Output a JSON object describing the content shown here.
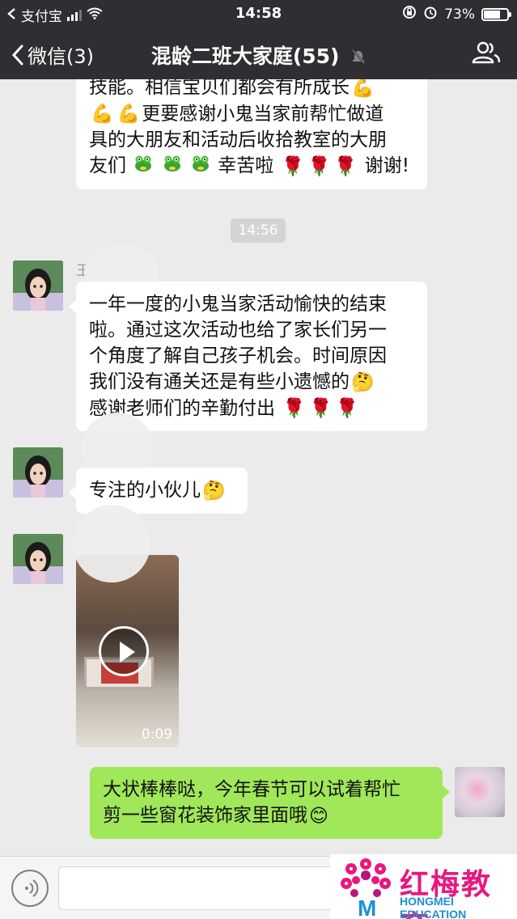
{
  "status_bar": {
    "carrier": "支付宝",
    "time": "14:58",
    "battery_percent": "73%",
    "battery_level": 0.73
  },
  "nav": {
    "back_label": "微信(3)",
    "title": "混龄二班大家庭(55)"
  },
  "messages": [
    {
      "id": "m1",
      "from": "other",
      "lines": [
        "技能。相信宝贝们都会有所成长",
        "更要感谢小鬼当家前帮忙做道",
        "具的大朋友和活动后收拾教室的大朋",
        "友们",
        "幸苦啦",
        "谢谢!"
      ]
    },
    {
      "id": "timestamp",
      "text": "14:56"
    },
    {
      "id": "m2",
      "from": "other",
      "name_fragment": "王",
      "lines": [
        "一年一度的小鬼当家活动愉快的结束",
        "啦。通过这次活动也给了家长们另一",
        "个角度了解自己孩子机会。时间原因",
        "我们没有通关还是有些小遗憾的",
        "感谢老师们的辛勤付出"
      ]
    },
    {
      "id": "m3",
      "from": "other",
      "lines": [
        "专注的小伙儿"
      ]
    },
    {
      "id": "m4",
      "from": "other",
      "type": "video",
      "duration": "0:09"
    },
    {
      "id": "m5",
      "from": "me",
      "lines": [
        "大状棒棒哒，今年春节可以试着帮忙",
        "剪一些窗花装饰家里面哦"
      ]
    }
  ],
  "watermark": {
    "cn": "红梅教育",
    "en": "HONGMEI EDUCATION"
  },
  "icons": {
    "muscle": "flexed-biceps-emoji",
    "frog": "green-frog-emoji",
    "rose": "red-rose-emoji",
    "thinking": "thinking-face-emoji",
    "smile": "smiling-face-emoji"
  },
  "colors": {
    "nav_bg": "#2e2e33",
    "chat_bg": "#ebebeb",
    "my_bubble": "#a0e75a",
    "other_bubble": "#ffffff",
    "logo_pink": "#e8177f",
    "logo_blue": "#1d8fd6"
  }
}
